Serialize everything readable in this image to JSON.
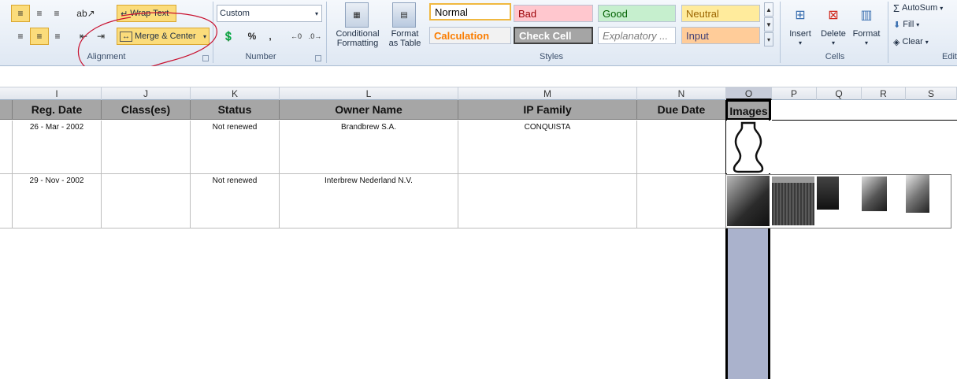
{
  "ribbon": {
    "alignment": {
      "label": "Alignment",
      "wrap_text": "Wrap Text",
      "merge_center": "Merge & Center"
    },
    "number": {
      "label": "Number",
      "format_value": "Custom",
      "percent": "%",
      "comma": ","
    },
    "styles": {
      "label": "Styles",
      "conditional_formatting": [
        "Conditional",
        "Formatting"
      ],
      "format_as_table": [
        "Format",
        "as Table"
      ],
      "cells": [
        {
          "name": "Normal",
          "bg": "#ffffff",
          "fg": "#000000"
        },
        {
          "name": "Bad",
          "bg": "#ffc7ce",
          "fg": "#9c0006"
        },
        {
          "name": "Good",
          "bg": "#c6efce",
          "fg": "#006100"
        },
        {
          "name": "Neutral",
          "bg": "#ffeb9c",
          "fg": "#9c6500"
        },
        {
          "name": "Calculation",
          "bg": "#f2f2f2",
          "fg": "#fa7d00"
        },
        {
          "name": "Check Cell",
          "bg": "#a5a5a5",
          "fg": "#ffffff"
        },
        {
          "name": "Explanatory ...",
          "bg": "#ffffff",
          "fg": "#7f7f7f"
        },
        {
          "name": "Input",
          "bg": "#ffcc99",
          "fg": "#3f3f76"
        }
      ]
    },
    "cells_group": {
      "label": "Cells",
      "insert": "Insert",
      "delete": "Delete",
      "format": "Format"
    },
    "editing": {
      "label": "Edit",
      "autosum": "AutoSum",
      "fill": "Fill",
      "clear": "Clear"
    }
  },
  "columns": [
    "I",
    "J",
    "K",
    "L",
    "M",
    "N",
    "O",
    "P",
    "Q",
    "R",
    "S"
  ],
  "headers": [
    "Reg. Date",
    "Class(es)",
    "Status",
    "Owner Name",
    "IP Family",
    "Due Date",
    "Images"
  ],
  "rows": [
    {
      "reg_date": "26 - Mar - 2002",
      "classes": "",
      "status": "Not renewed",
      "owner": "Brandbrew S.A.",
      "ip_family": "CONQUISTA",
      "due_date": ""
    },
    {
      "reg_date": "29 - Nov - 2002",
      "classes": "",
      "status": "Not renewed",
      "owner": "Interbrew Nederland N.V.",
      "ip_family": "",
      "due_date": ""
    }
  ],
  "colors": {
    "header_fill": "#a6a6a6",
    "selected_column": "#aab2cc",
    "annotation_red": "#c8102e"
  }
}
